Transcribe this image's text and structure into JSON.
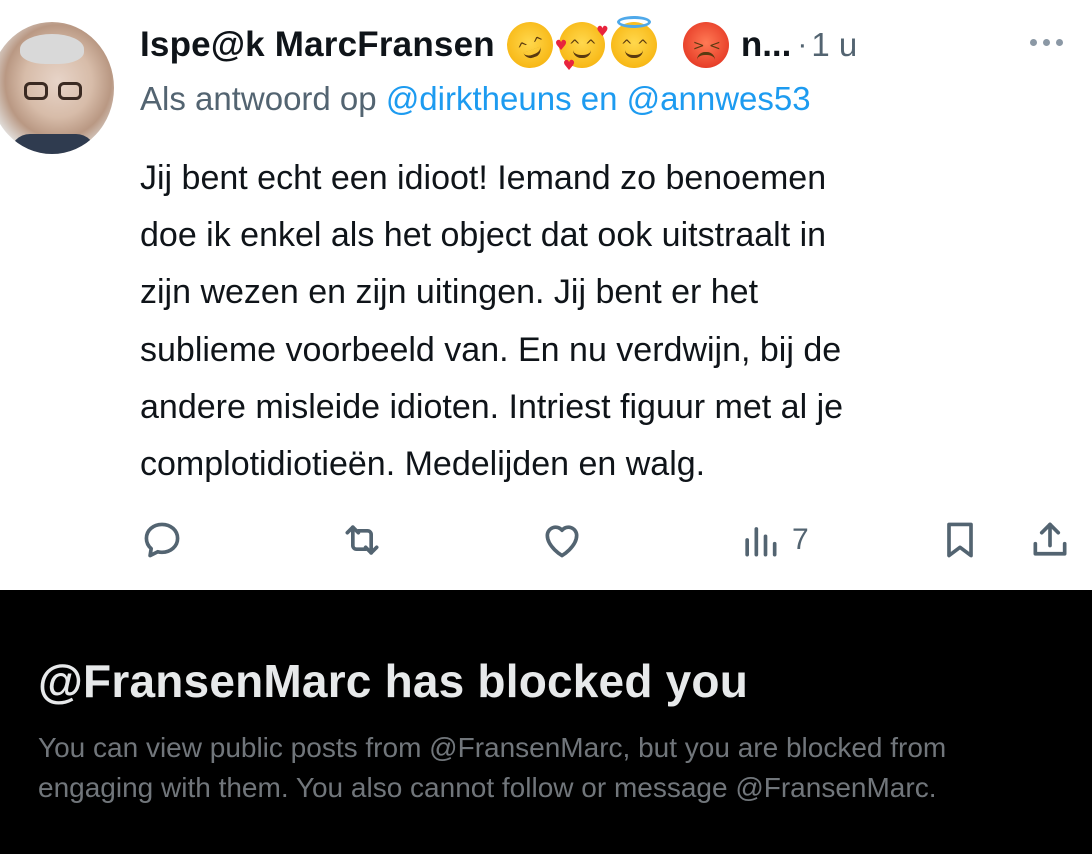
{
  "tweet": {
    "display_name": "Ispe@k MarcFransen",
    "name_truncated": "n...",
    "separator": "·",
    "time": "1 u",
    "emojis": [
      "rofl-emoji",
      "smiling-face-with-hearts-emoji",
      "smiling-face-with-halo-emoji",
      "angry-face-emoji"
    ],
    "reply_prefix": "Als antwoord op",
    "reply_user_1": "@dirktheuns",
    "reply_joiner": "en",
    "reply_user_2": "@annwes53",
    "text_lines": [
      "Jij bent echt een idioot! Iemand zo benoemen",
      "doe ik enkel als het object dat ook uitstraalt in",
      "zijn wezen en zijn uitingen. Jij bent er het",
      "sublieme voorbeeld van. En nu verdwijn, bij de",
      "andere misleide idioten. Intriest figuur met al je",
      "complotidiotieën. Medelijden en walg."
    ],
    "views_count": "7",
    "link_color": "#1d9bf0",
    "secondary_text_color": "#536471"
  },
  "blocked": {
    "title": "@FransenMarc has blocked you",
    "description": "You can view public posts from @FransenMarc, but you are blocked from engaging with them. You also cannot follow or message @FransenMarc.",
    "background": "#000000"
  }
}
